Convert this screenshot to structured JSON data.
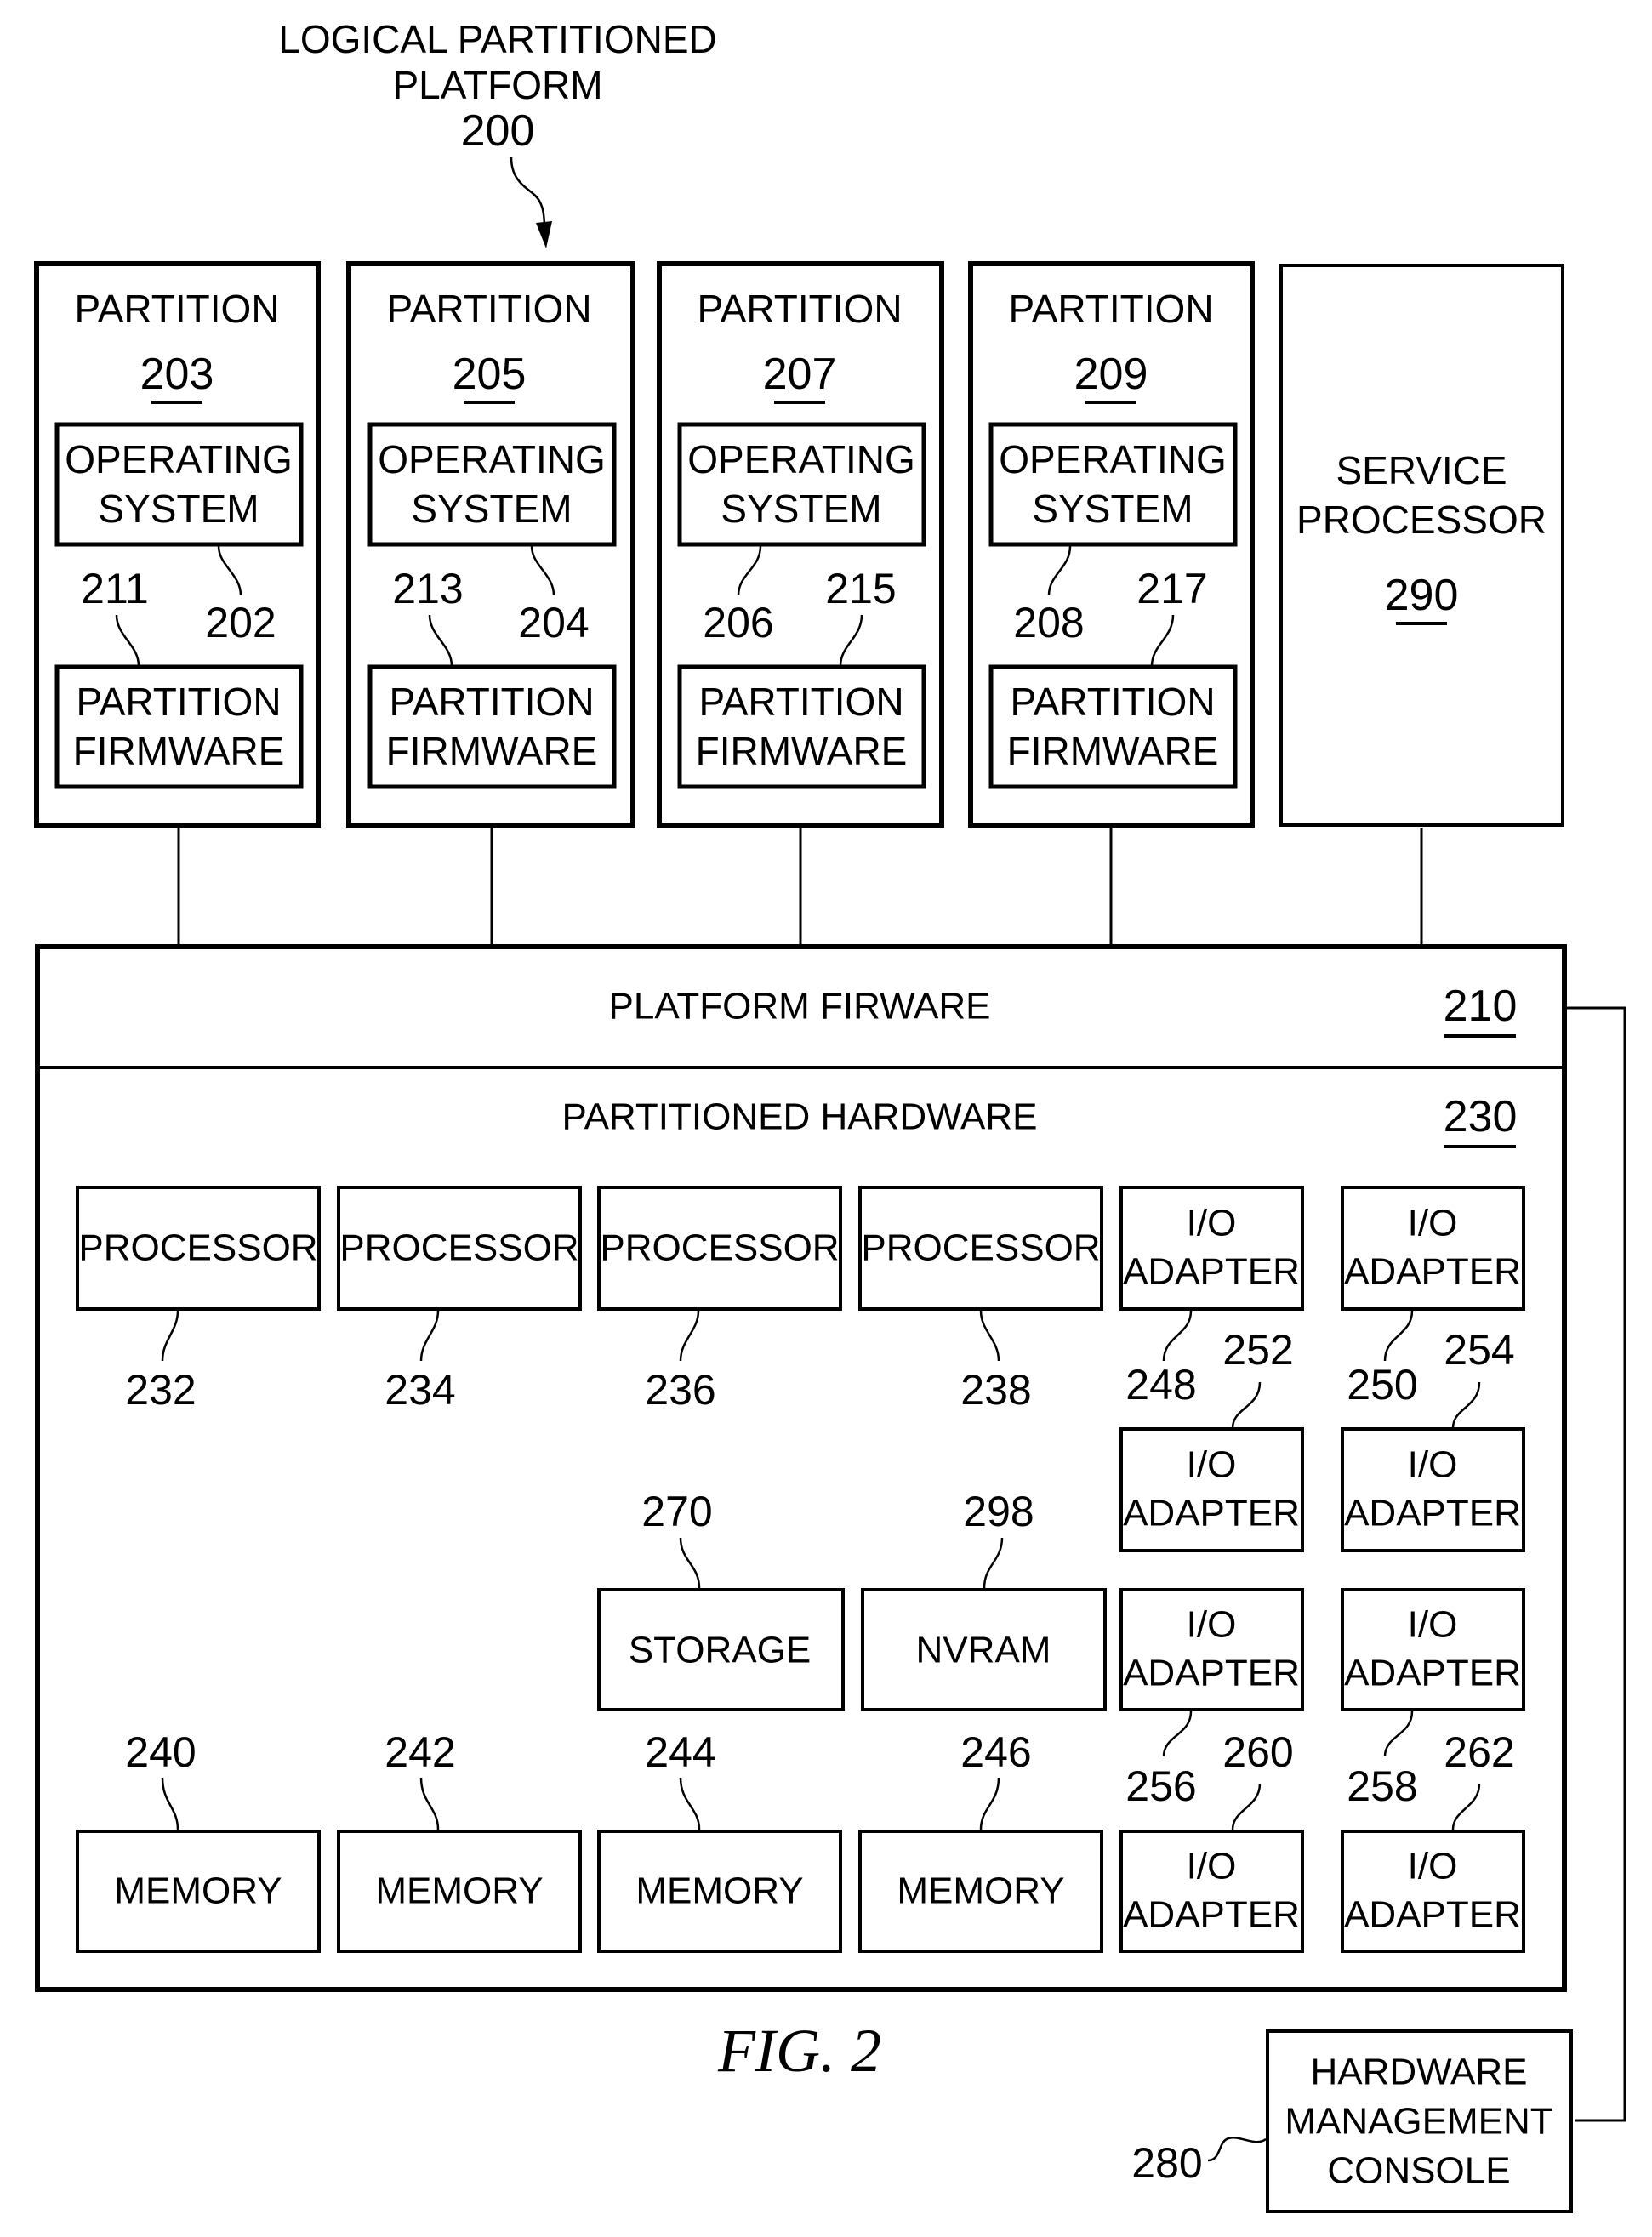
{
  "figure": {
    "title_lines": [
      "LOGICAL PARTITIONED",
      "PLATFORM"
    ],
    "ref": "200",
    "caption": "FIG. 2"
  },
  "partitions": [
    {
      "title": "PARTITION",
      "ref": "203",
      "os_lines": [
        "OPERATING",
        "SYSTEM"
      ],
      "os_ref": "202",
      "fw_lines": [
        "PARTITION",
        "FIRMWARE"
      ],
      "fw_ref": "211"
    },
    {
      "title": "PARTITION",
      "ref": "205",
      "os_lines": [
        "OPERATING",
        "SYSTEM"
      ],
      "os_ref": "204",
      "fw_lines": [
        "PARTITION",
        "FIRMWARE"
      ],
      "fw_ref": "213"
    },
    {
      "title": "PARTITION",
      "ref": "207",
      "os_lines": [
        "OPERATING",
        "SYSTEM"
      ],
      "os_ref": "206",
      "fw_lines": [
        "PARTITION",
        "FIRMWARE"
      ],
      "fw_ref": "215"
    },
    {
      "title": "PARTITION",
      "ref": "209",
      "os_lines": [
        "OPERATING",
        "SYSTEM"
      ],
      "os_ref": "208",
      "fw_lines": [
        "PARTITION",
        "FIRMWARE"
      ],
      "fw_ref": "217"
    }
  ],
  "service_processor": {
    "lines": [
      "SERVICE",
      "PROCESSOR"
    ],
    "ref": "290"
  },
  "platform_firmware": {
    "label": "PLATFORM FIRWARE",
    "ref": "210"
  },
  "partitioned_hardware": {
    "label": "PARTITIONED HARDWARE",
    "ref": "230"
  },
  "processors": [
    {
      "label": "PROCESSOR",
      "ref": "232"
    },
    {
      "label": "PROCESSOR",
      "ref": "234"
    },
    {
      "label": "PROCESSOR",
      "ref": "236"
    },
    {
      "label": "PROCESSOR",
      "ref": "238"
    }
  ],
  "storage": {
    "label": "STORAGE",
    "ref": "270"
  },
  "nvram": {
    "label": "NVRAM",
    "ref": "298"
  },
  "memories": [
    {
      "label": "MEMORY",
      "ref": "240"
    },
    {
      "label": "MEMORY",
      "ref": "242"
    },
    {
      "label": "MEMORY",
      "ref": "244"
    },
    {
      "label": "MEMORY",
      "ref": "246"
    }
  ],
  "io_adapters": [
    {
      "lines": [
        "I/O",
        "ADAPTER"
      ],
      "ref": "248"
    },
    {
      "lines": [
        "I/O",
        "ADAPTER"
      ],
      "ref": "250"
    },
    {
      "lines": [
        "I/O",
        "ADAPTER"
      ],
      "ref": "252"
    },
    {
      "lines": [
        "I/O",
        "ADAPTER"
      ],
      "ref": "254"
    },
    {
      "lines": [
        "I/O",
        "ADAPTER"
      ],
      "ref": "256"
    },
    {
      "lines": [
        "I/O",
        "ADAPTER"
      ],
      "ref": "258"
    },
    {
      "lines": [
        "I/O",
        "ADAPTER"
      ],
      "ref": "260"
    },
    {
      "lines": [
        "I/O",
        "ADAPTER"
      ],
      "ref": "262"
    }
  ],
  "hmc": {
    "lines": [
      "HARDWARE",
      "MANAGEMENT",
      "CONSOLE"
    ],
    "ref": "280"
  }
}
